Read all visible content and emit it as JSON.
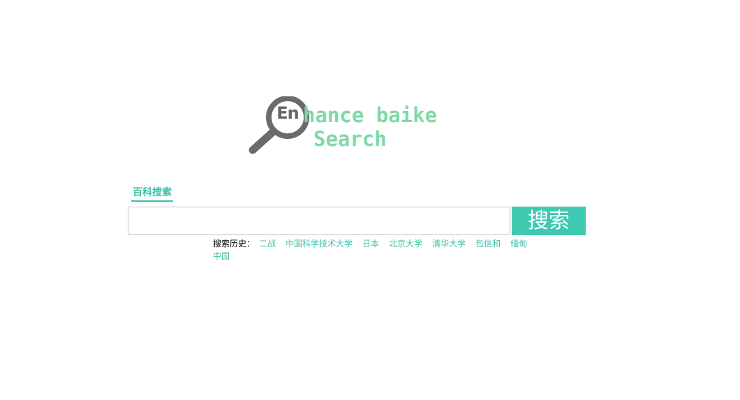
{
  "logo": {
    "prefix": "En",
    "line1": "hance baike",
    "line2": "Search"
  },
  "tab": {
    "label": "百科搜索"
  },
  "search": {
    "value": "",
    "button_label": "搜索"
  },
  "history": {
    "label": "搜索历史：",
    "items": [
      "二战",
      "中国科学技术大学",
      "日本",
      "北京大学",
      "清华大学",
      "包信和",
      "缅甸",
      "中国"
    ]
  },
  "colors": {
    "accent": "#3fc9b1",
    "logo_text": "#7fd9a6",
    "logo_icon": "#666666"
  }
}
